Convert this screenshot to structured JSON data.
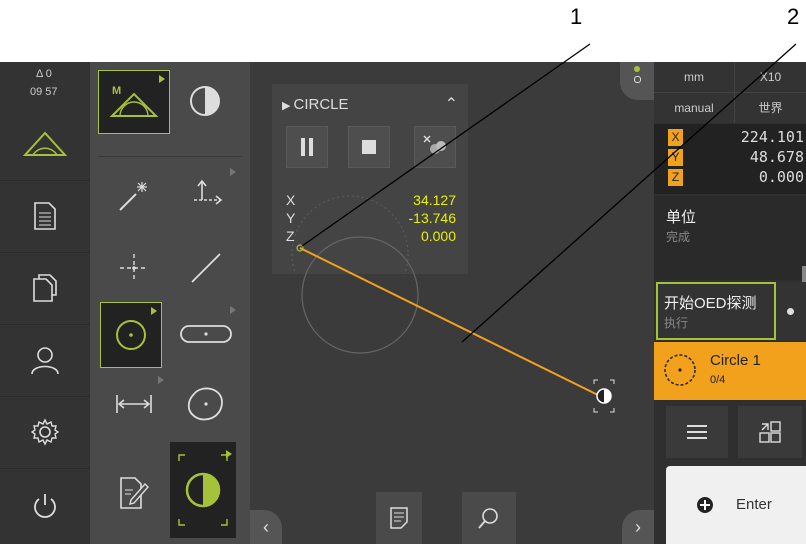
{
  "callouts": [
    "1",
    "2"
  ],
  "status": {
    "delta": "Δ 0",
    "time": "09 57"
  },
  "nav": {
    "items": [
      "measure",
      "protocol",
      "file-management",
      "user-login",
      "settings",
      "switch-off"
    ]
  },
  "panel": {
    "title": "CIRCLE",
    "coords": [
      {
        "axis": "X",
        "value": "34.127"
      },
      {
        "axis": "Y",
        "value": "-13.746"
      },
      {
        "axis": "Z",
        "value": "0.000"
      }
    ]
  },
  "right": {
    "unit": "mm",
    "zoom": "X10",
    "mode": "manual",
    "world": "世界",
    "positions": [
      {
        "axis": "X",
        "value": "224.101"
      },
      {
        "axis": "Y",
        "value": "48.678"
      },
      {
        "axis": "Z",
        "value": "0.000"
      }
    ],
    "unit_item": {
      "title": "单位",
      "sub": "完成"
    },
    "oed_item": {
      "title": "开始OED探测",
      "sub": "执行"
    },
    "feature": {
      "name": "Circle 1",
      "progress": "0/4"
    },
    "enter_label": "Enter"
  },
  "colors": {
    "accent": "#f2a11c",
    "highlight": "#a6c23a",
    "value": "#e8f000"
  }
}
